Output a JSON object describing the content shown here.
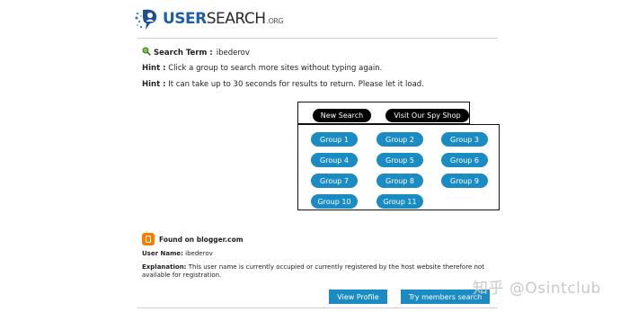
{
  "site": {
    "logo_user": "USER",
    "logo_search": "SEARCH",
    "logo_org": ".ORG"
  },
  "search": {
    "term_label": "Search Term :",
    "term_value": "ibederov"
  },
  "hints": [
    {
      "label": "Hint :",
      "text": "Click a group to search more sites without typing again."
    },
    {
      "label": "Hint :",
      "text": "It can take up to 30 seconds for results to return. Please let it load."
    }
  ],
  "actions": {
    "new_search": "New Search",
    "spy_shop": "Visit Our Spy Shop"
  },
  "groups": [
    "Group 1",
    "Group 2",
    "Group 3",
    "Group 4",
    "Group 5",
    "Group 6",
    "Group 7",
    "Group 8",
    "Group 9",
    "Group 10",
    "Group 11"
  ],
  "result": {
    "found_label": "Found on blogger.com",
    "username_label": "User Name:",
    "username_value": "ibederov",
    "explanation_label": "Explanation:",
    "explanation_text": "This user name is currently occupied or currently registered by the host website therefore not available for registration.",
    "view_profile": "View Profile",
    "try_members": "Try members search"
  },
  "watermark": "知乎 @Osintclub",
  "colors": {
    "accent": "#1a8cc3",
    "black_button": "#000000",
    "blogger": "#f57d00"
  }
}
